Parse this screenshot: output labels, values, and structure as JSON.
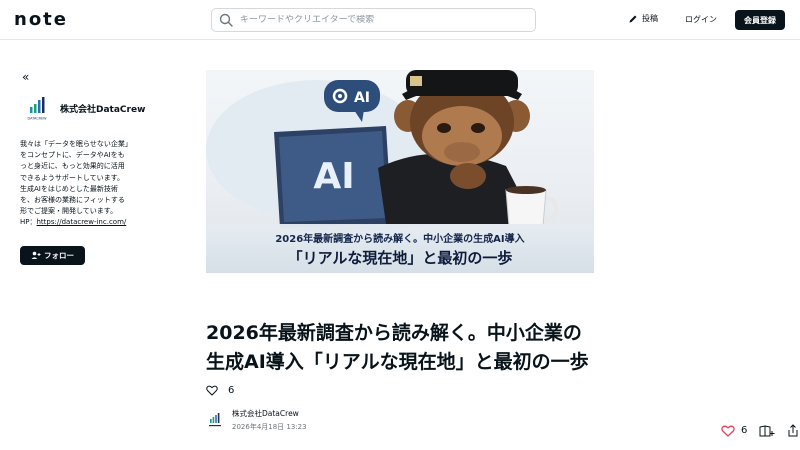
{
  "header": {
    "logo_text": "note",
    "search_placeholder": "キーワードやクリエイターで検索",
    "post_label": "投稿",
    "login_label": "ログイン",
    "signup_label": "会員登録"
  },
  "sidebar": {
    "creator_name": "株式会社DataCrew",
    "logo_caption": "DATACREW",
    "bio_lines": [
      "我々は「データを眠らせない企業」",
      "をコンセプトに、データやAIをも",
      "っと身近に、もっと効果的に活用",
      "できるようサポートしています。",
      "生成AIをはじめとした最新技術",
      "を、お客様の業務にフィットする",
      "形でご提案・開発しています。"
    ],
    "hp_prefix": "HP：",
    "hp_link": "https://datacrew-inc.com/",
    "follow_label": "フォロー"
  },
  "hero": {
    "bubble_text": "AI",
    "laptop_text": "AI",
    "caption_line1": "2026年最新調査から読み解く。中小企業の生成AI導入",
    "caption_line2": "「リアルな現在地」と最初の一歩"
  },
  "article": {
    "title_line1": "2026年最新調査から読み解く。中小企業の",
    "title_line2": "生成AI導入「リアルな現在地」と最初の一歩",
    "like_count": "6",
    "author_name": "株式会社DataCrew",
    "date": "2026年4月18日 13:23"
  },
  "actions": {
    "like_count": "6"
  },
  "colors": {
    "primary": "#08131a",
    "like_accent": "#e0435f"
  }
}
